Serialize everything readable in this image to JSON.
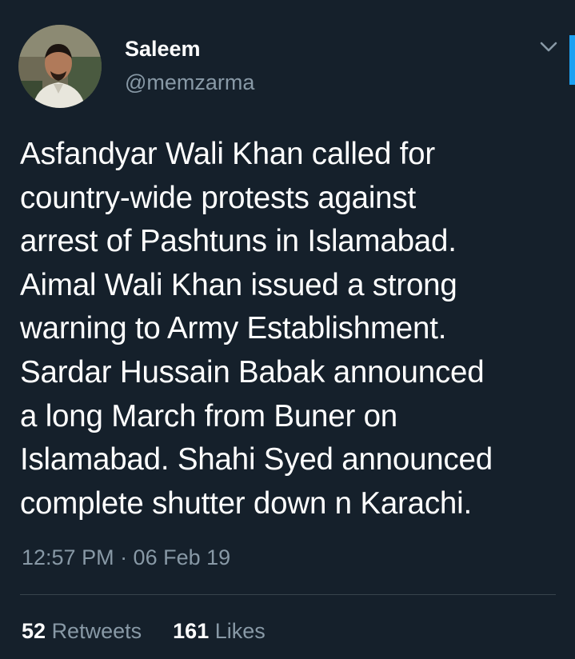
{
  "user": {
    "display_name": "Saleem",
    "handle": "@memzarma",
    "avatar_icon": "user-photo"
  },
  "tweet": {
    "text": "Asfandyar Wali Khan called for\ncountry-wide protests against\narrest of Pashtuns in Islamabad.\nAimal Wali Khan issued a strong\nwarning to Army Establishment.\nSardar Hussain Babak announced\na long March from Buner on\nIslamabad. Shahi Syed announced\ncomplete shutter down n Karachi.",
    "timestamp": "12:57 PM · 06 Feb 19"
  },
  "stats": {
    "retweets_count": "52",
    "retweets_label": "Retweets",
    "likes_count": "161",
    "likes_label": "Likes"
  },
  "menu": {
    "icon": "chevron-down-icon"
  },
  "colors": {
    "background": "#15202b",
    "text_primary": "#ffffff",
    "text_secondary": "#8899a6",
    "divider": "#38444d",
    "accent": "#1da1f2"
  }
}
